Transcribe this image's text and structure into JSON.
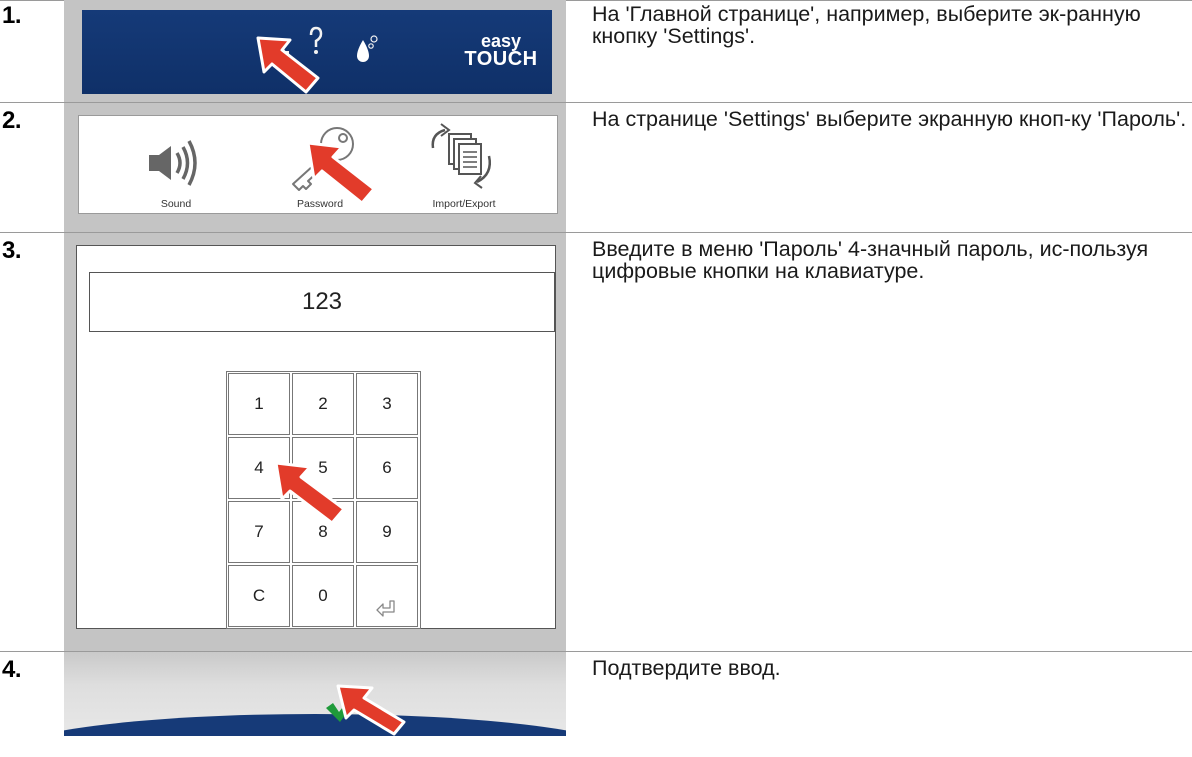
{
  "steps": [
    {
      "number": "1.",
      "text": "На 'Главной странице', например, выберите эк-ранную кнопку 'Settings'.",
      "screen": {
        "brand_line1": "easy",
        "brand_line2": "TOUCH",
        "icons": [
          "settings-gear-icon",
          "help-icon",
          "water-drop-icon"
        ]
      }
    },
    {
      "number": "2.",
      "text": "На странице 'Settings' выберите экранную кноп-ку 'Пароль'.",
      "screen": {
        "items": [
          {
            "icon": "speaker-icon",
            "label": "Sound"
          },
          {
            "icon": "key-icon",
            "label": "Password"
          },
          {
            "icon": "documents-exchange-icon",
            "label": "Import/Export"
          }
        ]
      }
    },
    {
      "number": "3.",
      "text": "Введите в меню 'Пароль' 4-значный пароль, ис-пользуя цифровые кнопки на клавиатуре.",
      "screen": {
        "password_value": "123",
        "keys": [
          "1",
          "2",
          "3",
          "4",
          "5",
          "6",
          "7",
          "8",
          "9",
          "C",
          "0",
          "⏎"
        ]
      }
    },
    {
      "number": "4.",
      "text": "Подтвердите ввод.",
      "screen": {
        "icons": [
          "checkmark-icon"
        ]
      }
    }
  ],
  "colors": {
    "accent_blue": "#153a78",
    "frame_gray": "#c4c4c4",
    "pointer_red": "#e23b2a",
    "check_green": "#1f9a3a"
  }
}
